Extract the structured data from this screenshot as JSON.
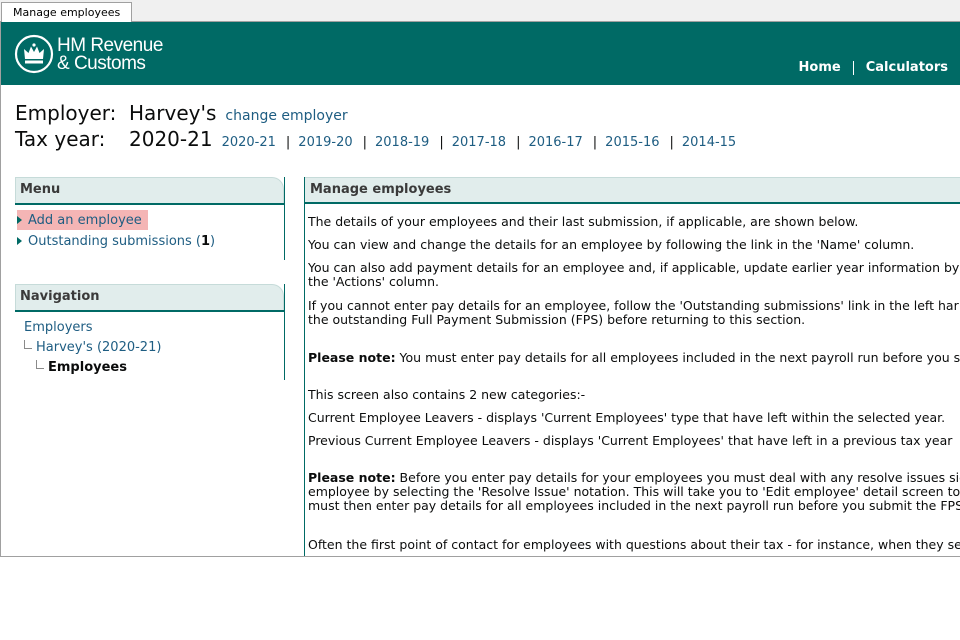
{
  "window": {
    "tab_title": "Manage employees"
  },
  "header": {
    "logo_line1": "HM Revenue",
    "logo_line2": "& Customs",
    "nav": [
      "Home",
      "Calculators"
    ]
  },
  "employer": {
    "label": "Employer:",
    "name": "Harvey's",
    "change_link": "change employer"
  },
  "tax_year": {
    "label": "Tax year:",
    "current": "2020-21",
    "years": [
      "2020-21",
      "2019-20",
      "2018-19",
      "2017-18",
      "2016-17",
      "2015-16",
      "2014-15"
    ]
  },
  "menu": {
    "title": "Menu",
    "add_employee": "Add an employee",
    "outstanding_label": "Outstanding submissions (",
    "outstanding_count": "1",
    "outstanding_close": ")"
  },
  "navigation": {
    "title": "Navigation",
    "employers": "Employers",
    "employer_year": "Harvey's (2020-21)",
    "employees": "Employees"
  },
  "main": {
    "title": "Manage employees",
    "p1": "The details of your employees and their last submission, if applicable, are shown below.",
    "p2": "You can view and change the details for an employee by following the link in the 'Name' column.",
    "p3a": "You can also add payment details for an employee and, if applicable, update earlier year information by",
    "p3b": "the 'Actions' column.",
    "p4a": "If you cannot enter pay details for an employee, follow the 'Outstanding submissions' link in the left har",
    "p4b": "the outstanding Full Payment Submission (FPS) before returning to this section.",
    "note_label": "Please note:",
    "note1": " You must enter pay details for all employees included in the next payroll run before you su",
    "p5": "This screen also contains 2 new categories:-",
    "p6": "Current Employee Leavers - displays 'Current Employees' type that have left within the selected year.",
    "p7": "Previous Current Employee Leavers - displays 'Current Employees' that have left in a previous tax year",
    "note2a": " Before you enter pay details for your employees you must deal with any resolve issues sig",
    "note2b": "employee by selecting the 'Resolve Issue' notation. This will take you to 'Edit employee' detail screen to",
    "note2c": "must then enter pay details for all employees included in the next payroll run before you submit the FPS",
    "p8": "Often the first point of contact for employees with questions about their tax - for instance, when they se"
  },
  "colors": {
    "brand": "#006a65",
    "link": "#1e5d82",
    "highlight": "#f4b5b5",
    "panel_bg": "#e1edec"
  }
}
